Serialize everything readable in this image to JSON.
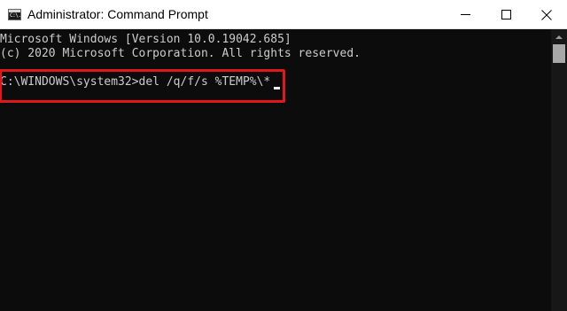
{
  "window": {
    "title": "Administrator: Command Prompt",
    "icon_text": "C:\\.",
    "icon": "command-prompt-icon",
    "controls": [
      "minimize-icon",
      "maximize-icon",
      "close-icon"
    ]
  },
  "console": {
    "lines": [
      "Microsoft Windows [Version 10.0.19042.685]",
      "(c) 2020 Microsoft Corporation. All rights reserved."
    ],
    "prompt": "C:\\WINDOWS\\system32>",
    "command": "del /q/f/s %TEMP%\\*",
    "text_color": "#cccccc",
    "background": "#0c0c0c"
  },
  "highlight": {
    "color": "#e0181b"
  }
}
